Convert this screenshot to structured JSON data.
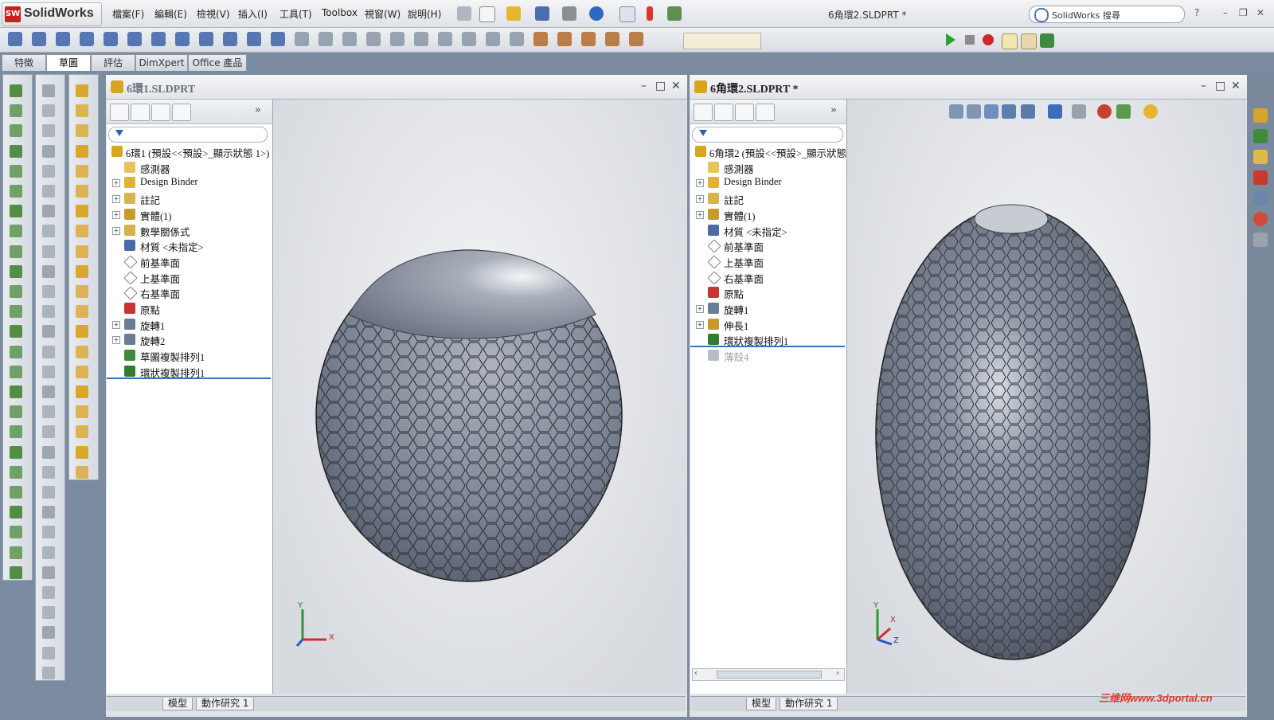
{
  "app": {
    "logo_text": "SolidWorks",
    "logo_badge": "SW"
  },
  "menu": [
    "檔案(F)",
    "編輯(E)",
    "檢視(V)",
    "插入(I)",
    "工具(T)",
    "Toolbox",
    "視窗(W)",
    "說明(H)"
  ],
  "document_title": "6角環2.SLDPRT *",
  "search": {
    "placeholder": "SolidWorks 搜尋"
  },
  "tabs": [
    "特徵",
    "草圖",
    "評估",
    "DimXpert",
    "Office 產品"
  ],
  "active_tab": "草圖",
  "window_left": {
    "title": "6環1.SLDPRT",
    "tree": [
      {
        "label": "6環1 (預設<<預設>_顯示狀態 1>)",
        "icon": "part-icon",
        "expandable": false,
        "dim": false
      },
      {
        "label": "感測器",
        "icon": "sensor-icon",
        "expandable": false,
        "dim": false
      },
      {
        "label": "Design Binder",
        "icon": "design-binder-icon",
        "expandable": true,
        "dim": false
      },
      {
        "label": "註記",
        "icon": "annotations-icon",
        "expandable": true,
        "dim": false
      },
      {
        "label": "實體(1)",
        "icon": "solid-bodies-icon",
        "expandable": true,
        "dim": false
      },
      {
        "label": "數學關係式",
        "icon": "equations-icon",
        "expandable": true,
        "dim": false
      },
      {
        "label": "材質 <未指定>",
        "icon": "material-icon",
        "expandable": false,
        "dim": false
      },
      {
        "label": "前基準面",
        "icon": "plane-icon",
        "expandable": false,
        "dim": false
      },
      {
        "label": "上基準面",
        "icon": "plane-icon",
        "expandable": false,
        "dim": false
      },
      {
        "label": "右基準面",
        "icon": "plane-icon",
        "expandable": false,
        "dim": false
      },
      {
        "label": "原點",
        "icon": "origin-icon",
        "expandable": false,
        "dim": false
      },
      {
        "label": "旋轉1",
        "icon": "revolve-icon",
        "expandable": true,
        "dim": false
      },
      {
        "label": "旋轉2",
        "icon": "revolve-icon",
        "expandable": true,
        "dim": false
      },
      {
        "label": "草圖複製排列1",
        "icon": "sketch-pattern-icon",
        "expandable": false,
        "dim": false
      },
      {
        "label": "環狀複製排列1",
        "icon": "circular-pattern-icon",
        "expandable": false,
        "dim": false
      }
    ],
    "bottom_tabs": [
      "模型",
      "動作研究 1"
    ]
  },
  "window_right": {
    "title": "6角環2.SLDPRT *",
    "tree": [
      {
        "label": "6角環2 (預設<<預設>_顯示狀態",
        "icon": "part-icon",
        "expandable": false,
        "dim": false
      },
      {
        "label": "感測器",
        "icon": "sensor-icon",
        "expandable": false,
        "dim": false
      },
      {
        "label": "Design Binder",
        "icon": "design-binder-icon",
        "expandable": true,
        "dim": false
      },
      {
        "label": "註記",
        "icon": "annotations-icon",
        "expandable": true,
        "dim": false
      },
      {
        "label": "實體(1)",
        "icon": "solid-bodies-icon",
        "expandable": true,
        "dim": false
      },
      {
        "label": "材質 <未指定>",
        "icon": "material-icon",
        "expandable": false,
        "dim": false
      },
      {
        "label": "前基準面",
        "icon": "plane-icon",
        "expandable": false,
        "dim": false
      },
      {
        "label": "上基準面",
        "icon": "plane-icon",
        "expandable": false,
        "dim": false
      },
      {
        "label": "右基準面",
        "icon": "plane-icon",
        "expandable": false,
        "dim": false
      },
      {
        "label": "原點",
        "icon": "origin-icon",
        "expandable": false,
        "dim": false
      },
      {
        "label": "旋轉1",
        "icon": "revolve-icon",
        "expandable": true,
        "dim": false
      },
      {
        "label": "伸長1",
        "icon": "extrude-icon",
        "expandable": true,
        "dim": false
      },
      {
        "label": "環狀複製排列1",
        "icon": "circular-pattern-icon",
        "expandable": false,
        "dim": false
      },
      {
        "label": "薄殼4",
        "icon": "shell-icon",
        "expandable": false,
        "dim": true
      }
    ],
    "bottom_tabs": [
      "模型",
      "動作研究 1"
    ]
  },
  "axes": {
    "x": "X",
    "y": "Y",
    "z": "Z"
  },
  "watermark": "三维网www.3dportal.cn",
  "colors": {
    "accent": "#3a6fb8",
    "viewport": "#d7dadf",
    "model": "#6e7787",
    "brand": "#c8211f"
  }
}
